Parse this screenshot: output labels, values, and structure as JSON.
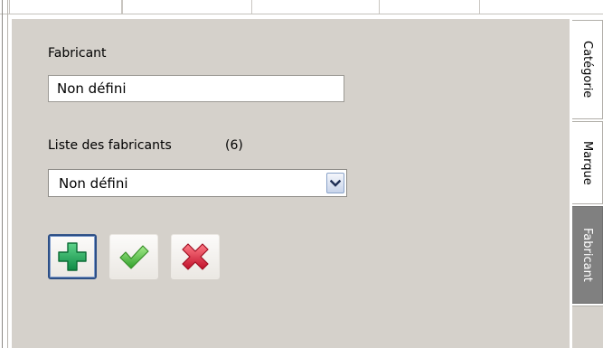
{
  "form": {
    "fabricant_label": "Fabricant",
    "fabricant_value": "Non défini",
    "list_label": "Liste des fabricants",
    "list_count": "(6)",
    "selected_value": "Non défini"
  },
  "actions": {
    "add_icon": "plus-icon",
    "confirm_icon": "checkmark-icon",
    "delete_icon": "cross-icon"
  },
  "tabs": [
    {
      "label": "Catégorie",
      "active": false
    },
    {
      "label": "Marque",
      "active": false
    },
    {
      "label": "Fabricant",
      "active": true
    }
  ],
  "colors": {
    "panel": "#d5d1cb",
    "active_tab": "#808080",
    "add_green": "#1aa35a",
    "check_green": "#4fc23a",
    "cross_red": "#d9223a"
  }
}
